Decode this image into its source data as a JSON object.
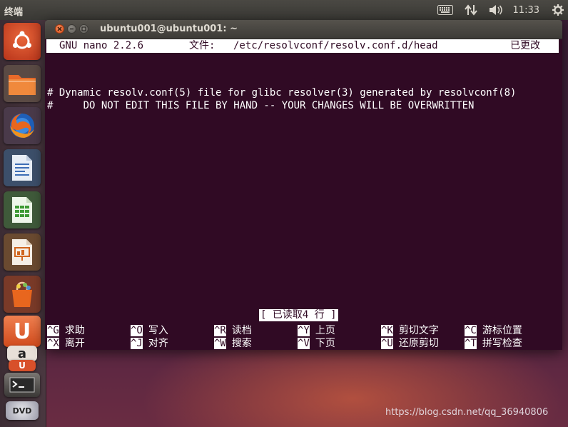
{
  "top_panel": {
    "app_title": "终端",
    "clock": "11:33",
    "icons": [
      "keyboard-icon",
      "network-icon",
      "volume-icon",
      "settings-gear-icon"
    ]
  },
  "launcher": {
    "items": [
      "ubuntu-dash-icon",
      "files-icon",
      "firefox-icon",
      "writer-icon",
      "calc-icon",
      "impress-icon",
      "software-center-icon",
      "ubuntu-one-icon",
      "amazon-icon",
      "ubuntu-one-icon-stack",
      "terminal-icon",
      "dvd-icon"
    ],
    "amazon_glyph": "a",
    "ubuntu_one_glyph": "U",
    "dvd_label": "DVD"
  },
  "window": {
    "title": "ubuntu001@ubuntu001: ~"
  },
  "nano": {
    "version": "GNU nano 2.2.6",
    "file_label": "文件:",
    "file_path": "/etc/resolvconf/resolv.conf.d/head",
    "modified": "已更改",
    "lines": [
      "# Dynamic resolv.conf(5) file for glibc resolver(3) generated by resolvconf(8)",
      "#     DO NOT EDIT THIS FILE BY HAND -- YOUR CHANGES WILL BE OVERWRITTEN"
    ],
    "status": "[ 已读取4 行 ]",
    "shortcuts_row1": [
      {
        "key": "^G",
        "label": "求助"
      },
      {
        "key": "^O",
        "label": "写入"
      },
      {
        "key": "^R",
        "label": "读档"
      },
      {
        "key": "^Y",
        "label": "上页"
      },
      {
        "key": "^K",
        "label": "剪切文字"
      },
      {
        "key": "^C",
        "label": "游标位置"
      }
    ],
    "shortcuts_row2": [
      {
        "key": "^X",
        "label": "离开"
      },
      {
        "key": "^J",
        "label": "对齐"
      },
      {
        "key": "^W",
        "label": "搜索"
      },
      {
        "key": "^V",
        "label": "下页"
      },
      {
        "key": "^U",
        "label": "还原剪切"
      },
      {
        "key": "^T",
        "label": "拼写检查"
      }
    ]
  },
  "watermark": "https://blog.csdn.net/qq_36940806",
  "colors": {
    "terminal_bg": "#300a24",
    "close_button": "#e0582a"
  }
}
